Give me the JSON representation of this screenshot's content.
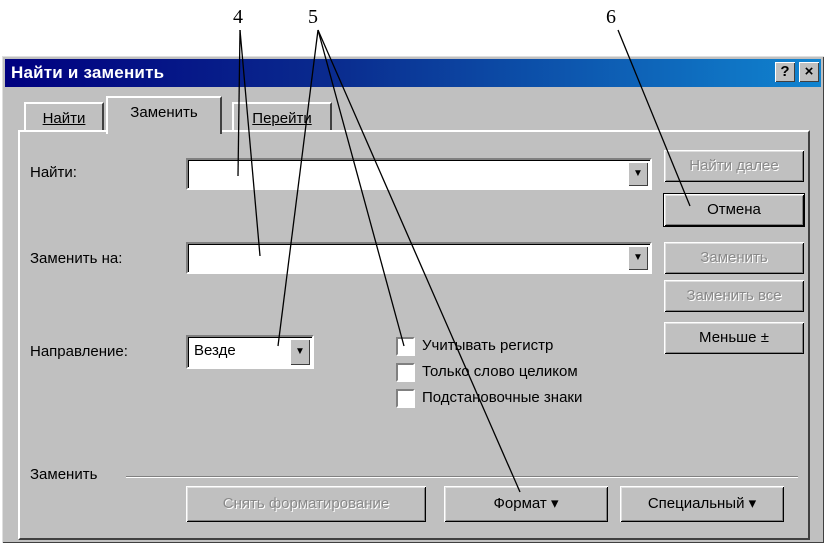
{
  "callouts": {
    "c4": "4",
    "c5": "5",
    "c6": "6"
  },
  "title": "Найти и заменить",
  "title_buttons": {
    "help": "?",
    "close": "×"
  },
  "tabs": [
    {
      "label": "Найти"
    },
    {
      "label": "Заменить"
    },
    {
      "label": "Перейти"
    }
  ],
  "find": {
    "label": "Найти:",
    "value": ""
  },
  "replace": {
    "label": "Заменить на:",
    "value": ""
  },
  "direction": {
    "label": "Направление:",
    "value": "Везде"
  },
  "options": [
    {
      "label": "Учитывать регистр",
      "checked": false
    },
    {
      "label": "Только слово целиком",
      "checked": false
    },
    {
      "label": "Подстановочные знаки",
      "checked": false
    }
  ],
  "buttons": {
    "find_next": "Найти далее",
    "cancel": "Отмена",
    "replace": "Заменить",
    "replace_all": "Заменить все",
    "less": "Меньше ±"
  },
  "replace_group": {
    "label": "Заменить",
    "clear_format": "Снять форматирование",
    "format": "Формат ▾",
    "special": "Специальный ▾"
  }
}
